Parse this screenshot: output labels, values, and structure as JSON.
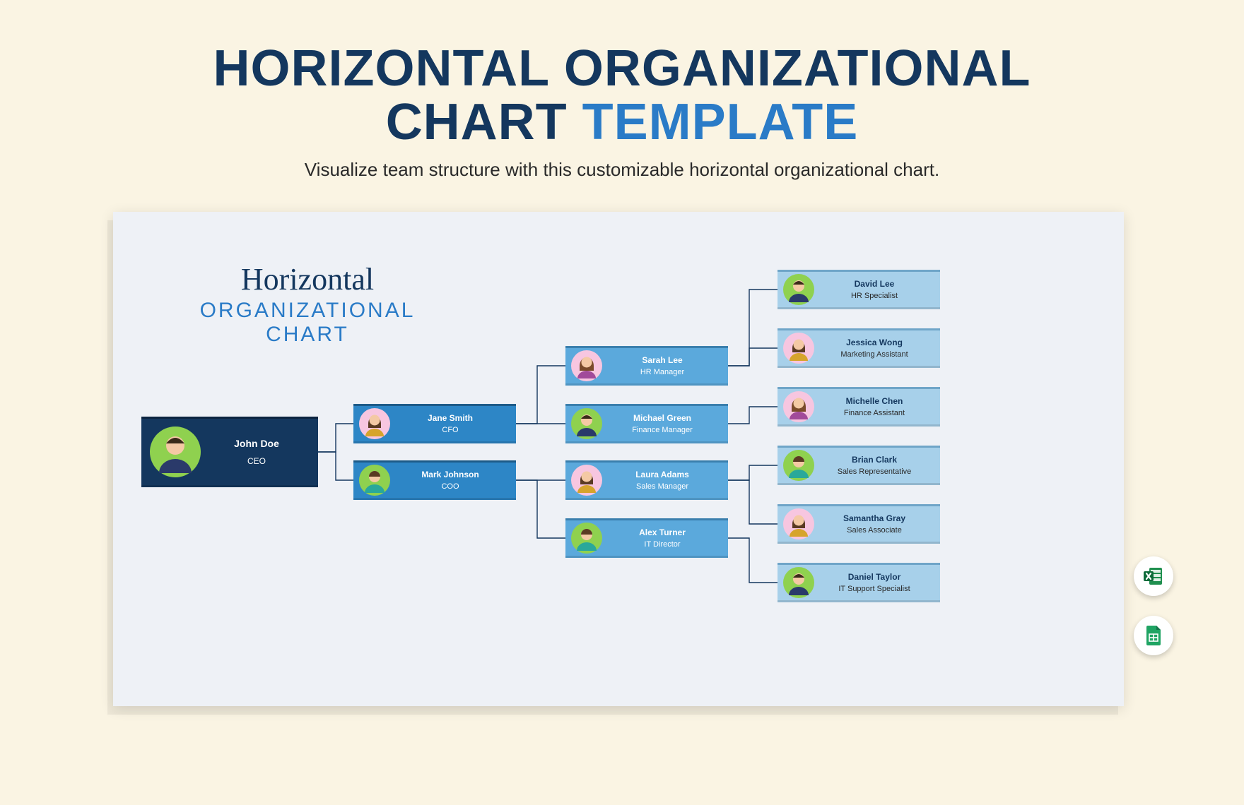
{
  "title": {
    "line1": "HORIZONTAL ORGANIZATIONAL",
    "line2_a": "CHART",
    "line2_b": "TEMPLATE"
  },
  "subtitle": "Visualize team structure with this customizable horizontal organizational chart.",
  "chart_heading": {
    "script": "Horizontal",
    "plain": "ORGANIZATIONAL CHART"
  },
  "org": {
    "ceo": {
      "name": "John Doe",
      "role": "CEO"
    },
    "level1": [
      {
        "name": "Jane Smith",
        "role": "CFO"
      },
      {
        "name": "Mark Johnson",
        "role": "COO"
      }
    ],
    "level2": [
      {
        "name": "Sarah Lee",
        "role": "HR Manager"
      },
      {
        "name": "Michael Green",
        "role": "Finance Manager"
      },
      {
        "name": "Laura Adams",
        "role": "Sales Manager"
      },
      {
        "name": "Alex Turner",
        "role": "IT Director"
      }
    ],
    "level3": [
      {
        "name": "David Lee",
        "role": "HR Specialist"
      },
      {
        "name": "Jessica Wong",
        "role": "Marketing Assistant"
      },
      {
        "name": "Michelle Chen",
        "role": "Finance Assistant"
      },
      {
        "name": "Brian Clark",
        "role": "Sales Representative"
      },
      {
        "name": "Samantha Gray",
        "role": "Sales Associate"
      },
      {
        "name": "Daniel Taylor",
        "role": "IT Support Specialist"
      }
    ]
  },
  "badges": {
    "excel": "Excel",
    "sheets": "Google Sheets"
  },
  "avatar_colors": {
    "green": "#8fd14f",
    "pink": "#f7c6e0",
    "yellow": "#f6c957",
    "skin": "#f4c9a4",
    "suit_navy": "#2a3a6a",
    "suit_teal": "#2aa89a",
    "suit_plum": "#a14a9a",
    "suit_gold": "#d6a42c"
  }
}
